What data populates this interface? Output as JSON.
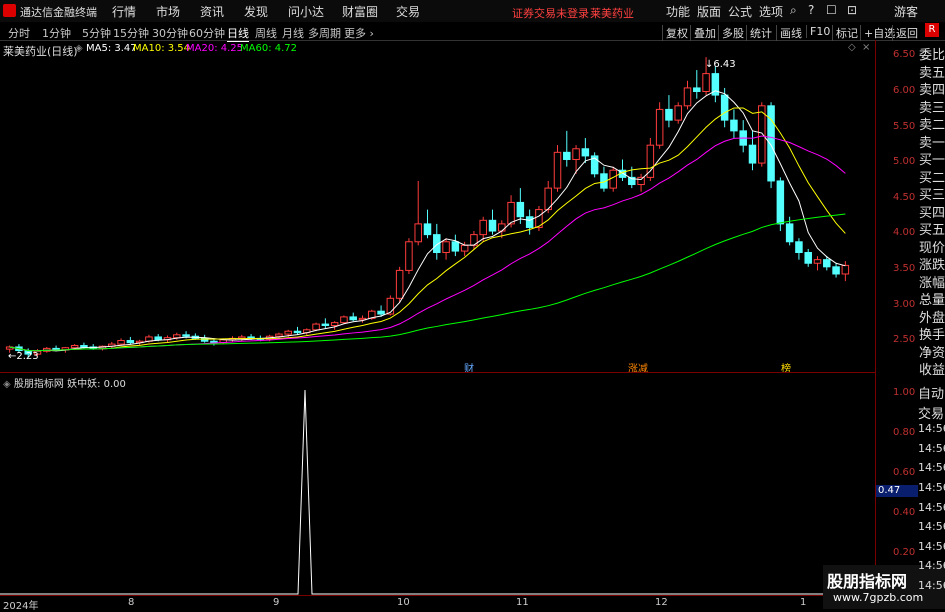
{
  "app": {
    "title": "通达信金融终端",
    "menu": [
      "行情",
      "市场",
      "资讯",
      "发现",
      "问小达",
      "财富圈",
      "交易"
    ],
    "notice": "证券交易未登录",
    "stock_name_header": "莱美药业",
    "right_menu": [
      "功能",
      "版面",
      "公式",
      "选项"
    ],
    "user": "游客"
  },
  "tabs": {
    "periods": [
      "分时",
      "1分钟",
      "5分钟",
      "15分钟",
      "30分钟",
      "60分钟",
      "日线",
      "周线",
      "月线",
      "多周期",
      "更多"
    ],
    "active": "日线",
    "buttons": [
      "复权",
      "叠加",
      "多股",
      "统计",
      "画线",
      "F10",
      "标记",
      "+自选",
      "返回"
    ],
    "r_badge": "R"
  },
  "main": {
    "stock_label": "莱美药业(日线)",
    "ma": [
      {
        "label": "MA5: 3.47",
        "color": "#ffffff"
      },
      {
        "label": "MA10: 3.54",
        "color": "#ffff00"
      },
      {
        "label": "MA20: 4.25",
        "color": "#ff00ff"
      },
      {
        "label": "MA60: 4.72",
        "color": "#00ff00"
      }
    ],
    "high_label": "6.43",
    "low_label": "2.23",
    "events": [
      "财",
      "涨减",
      "榜"
    ],
    "price_ticks": [
      "6.50",
      "6.00",
      "5.50",
      "5.00",
      "4.50",
      "4.00",
      "3.50",
      "3.00",
      "2.50"
    ]
  },
  "indicator": {
    "label": "股朋指标网  妖中妖: 0.00",
    "ticks": [
      "1.00",
      "0.80",
      "0.60",
      "0.40",
      "0.20"
    ],
    "current_value": "0.47"
  },
  "dates": [
    "2024年",
    "8",
    "9",
    "10",
    "11",
    "12",
    "1"
  ],
  "sidepanel": [
    "委比",
    "卖五",
    "卖四",
    "卖三",
    "卖二",
    "卖一",
    "买一",
    "买二",
    "买三",
    "买四",
    "买五",
    "现价",
    "涨跌",
    "涨幅",
    "总量",
    "外盘",
    "换手",
    "净资",
    "收益"
  ],
  "sidepanel_lower": [
    "自动",
    "交易",
    "14:56",
    "14:56",
    "14:56",
    "14:56",
    "14:56",
    "14:56",
    "14:56",
    "14:56",
    "14:56"
  ],
  "watermark": {
    "line1": "股朋指标网",
    "line2": "www.7gpzb.com"
  },
  "chart_data": {
    "type": "candlestick",
    "price_range": [
      2.1,
      6.6
    ],
    "candles": [
      [
        2.35,
        2.4,
        2.3,
        2.38
      ],
      [
        2.38,
        2.42,
        2.3,
        2.33
      ],
      [
        2.33,
        2.36,
        2.23,
        2.28
      ],
      [
        2.28,
        2.35,
        2.25,
        2.32
      ],
      [
        2.32,
        2.38,
        2.3,
        2.36
      ],
      [
        2.36,
        2.4,
        2.32,
        2.34
      ],
      [
        2.34,
        2.38,
        2.3,
        2.37
      ],
      [
        2.37,
        2.42,
        2.34,
        2.4
      ],
      [
        2.4,
        2.44,
        2.36,
        2.38
      ],
      [
        2.38,
        2.42,
        2.34,
        2.36
      ],
      [
        2.36,
        2.4,
        2.33,
        2.39
      ],
      [
        2.39,
        2.45,
        2.36,
        2.42
      ],
      [
        2.42,
        2.5,
        2.4,
        2.47
      ],
      [
        2.47,
        2.52,
        2.42,
        2.44
      ],
      [
        2.44,
        2.48,
        2.4,
        2.46
      ],
      [
        2.46,
        2.55,
        2.44,
        2.52
      ],
      [
        2.52,
        2.56,
        2.46,
        2.48
      ],
      [
        2.48,
        2.54,
        2.45,
        2.51
      ],
      [
        2.51,
        2.58,
        2.48,
        2.55
      ],
      [
        2.55,
        2.6,
        2.5,
        2.53
      ],
      [
        2.53,
        2.57,
        2.48,
        2.5
      ],
      [
        2.5,
        2.55,
        2.44,
        2.46
      ],
      [
        2.46,
        2.5,
        2.4,
        2.44
      ],
      [
        2.44,
        2.5,
        2.42,
        2.48
      ],
      [
        2.48,
        2.53,
        2.45,
        2.5
      ],
      [
        2.5,
        2.55,
        2.46,
        2.52
      ],
      [
        2.52,
        2.56,
        2.48,
        2.5
      ],
      [
        2.5,
        2.54,
        2.46,
        2.49
      ],
      [
        2.49,
        2.55,
        2.46,
        2.53
      ],
      [
        2.53,
        2.58,
        2.5,
        2.56
      ],
      [
        2.56,
        2.62,
        2.52,
        2.6
      ],
      [
        2.6,
        2.66,
        2.55,
        2.58
      ],
      [
        2.58,
        2.64,
        2.54,
        2.62
      ],
      [
        2.62,
        2.72,
        2.6,
        2.7
      ],
      [
        2.7,
        2.78,
        2.64,
        2.68
      ],
      [
        2.68,
        2.74,
        2.62,
        2.72
      ],
      [
        2.72,
        2.82,
        2.7,
        2.8
      ],
      [
        2.8,
        2.86,
        2.74,
        2.76
      ],
      [
        2.76,
        2.82,
        2.72,
        2.78
      ],
      [
        2.78,
        2.9,
        2.76,
        2.88
      ],
      [
        2.88,
        2.96,
        2.8,
        2.84
      ],
      [
        2.84,
        3.1,
        2.82,
        3.06
      ],
      [
        3.06,
        3.5,
        3.0,
        3.45
      ],
      [
        3.45,
        3.9,
        3.4,
        3.85
      ],
      [
        3.85,
        4.7,
        3.8,
        4.1
      ],
      [
        4.1,
        4.3,
        3.9,
        3.95
      ],
      [
        3.95,
        4.1,
        3.6,
        3.7
      ],
      [
        3.7,
        3.9,
        3.6,
        3.85
      ],
      [
        3.85,
        3.95,
        3.65,
        3.72
      ],
      [
        3.72,
        3.85,
        3.65,
        3.8
      ],
      [
        3.8,
        4.0,
        3.75,
        3.95
      ],
      [
        3.95,
        4.2,
        3.85,
        4.15
      ],
      [
        4.15,
        4.3,
        3.95,
        4.0
      ],
      [
        4.0,
        4.15,
        3.9,
        4.1
      ],
      [
        4.1,
        4.5,
        4.05,
        4.4
      ],
      [
        4.4,
        4.6,
        4.1,
        4.2
      ],
      [
        4.2,
        4.3,
        3.95,
        4.05
      ],
      [
        4.05,
        4.35,
        4.0,
        4.3
      ],
      [
        4.3,
        4.7,
        4.25,
        4.6
      ],
      [
        4.6,
        5.2,
        4.55,
        5.1
      ],
      [
        5.1,
        5.4,
        4.9,
        5.0
      ],
      [
        5.0,
        5.2,
        4.8,
        5.15
      ],
      [
        5.15,
        5.3,
        4.95,
        5.05
      ],
      [
        5.05,
        5.1,
        4.75,
        4.8
      ],
      [
        4.8,
        4.9,
        4.55,
        4.6
      ],
      [
        4.6,
        4.9,
        4.55,
        4.85
      ],
      [
        4.85,
        5.0,
        4.7,
        4.75
      ],
      [
        4.75,
        4.9,
        4.6,
        4.65
      ],
      [
        4.65,
        4.8,
        4.55,
        4.75
      ],
      [
        4.75,
        5.3,
        4.7,
        5.2
      ],
      [
        5.2,
        5.8,
        5.15,
        5.7
      ],
      [
        5.7,
        5.9,
        5.45,
        5.55
      ],
      [
        5.55,
        5.8,
        5.5,
        5.75
      ],
      [
        5.75,
        6.1,
        5.7,
        6.0
      ],
      [
        6.0,
        6.25,
        5.85,
        5.95
      ],
      [
        5.95,
        6.43,
        5.9,
        6.2
      ],
      [
        6.2,
        6.3,
        5.8,
        5.9
      ],
      [
        5.9,
        6.0,
        5.45,
        5.55
      ],
      [
        5.55,
        5.7,
        5.3,
        5.4
      ],
      [
        5.4,
        5.55,
        5.1,
        5.2
      ],
      [
        5.2,
        5.4,
        4.85,
        4.95
      ],
      [
        4.95,
        5.8,
        4.9,
        5.75
      ],
      [
        5.75,
        5.8,
        4.6,
        4.7
      ],
      [
        4.7,
        4.75,
        4.0,
        4.1
      ],
      [
        4.1,
        4.2,
        3.8,
        3.85
      ],
      [
        3.85,
        3.9,
        3.6,
        3.7
      ],
      [
        3.7,
        3.75,
        3.5,
        3.55
      ],
      [
        3.55,
        3.65,
        3.45,
        3.6
      ],
      [
        3.6,
        3.65,
        3.45,
        3.5
      ],
      [
        3.5,
        3.55,
        3.35,
        3.4
      ],
      [
        3.4,
        3.58,
        3.3,
        3.52
      ]
    ]
  }
}
